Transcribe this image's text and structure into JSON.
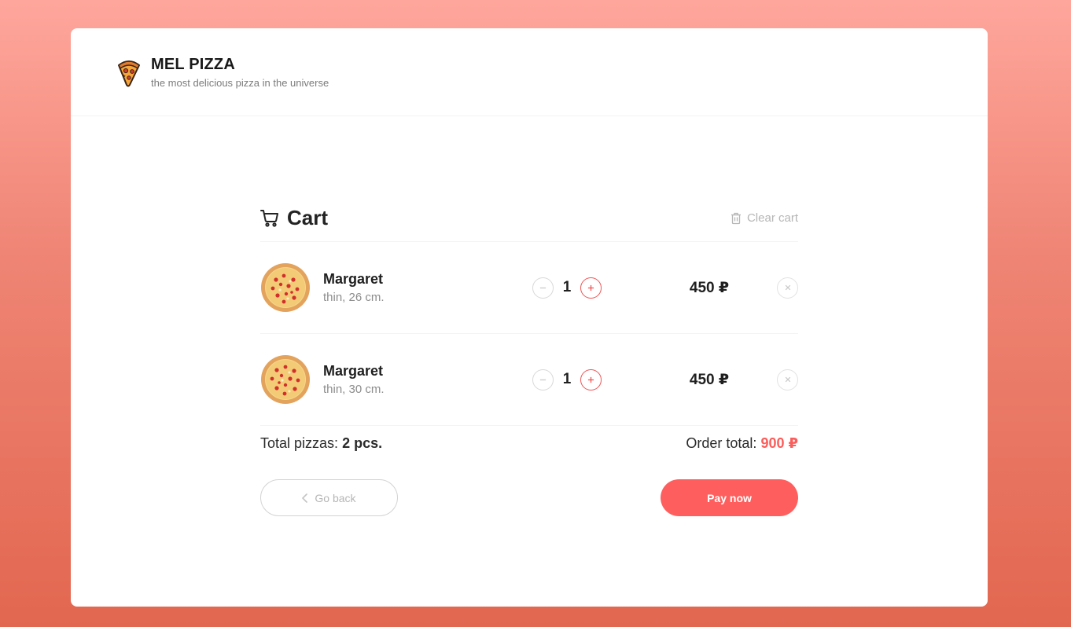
{
  "header": {
    "brand_title": "MEL PIZZA",
    "brand_subtitle": "the most delicious pizza in the universe",
    "logo_icon": "pizza-slice-icon"
  },
  "cart": {
    "title": "Cart",
    "title_icon": "cart-icon",
    "clear_label": "Clear cart",
    "clear_icon": "trash-icon",
    "items": [
      {
        "name": "Margaret",
        "desc": "thin, 26 cm.",
        "count": "1",
        "price": "450 ₽"
      },
      {
        "name": "Margaret",
        "desc": "thin, 30 cm.",
        "count": "1",
        "price": "450 ₽"
      }
    ],
    "total_pizzas_label": "Total pizzas:",
    "total_pizzas_value": "2 pcs.",
    "order_total_label": "Order total:",
    "order_total_value": "900 ₽",
    "back_label": "Go back",
    "pay_label": "Pay now"
  },
  "colors": {
    "accent": "#fe5f5e",
    "text": "#1f1f1f"
  }
}
